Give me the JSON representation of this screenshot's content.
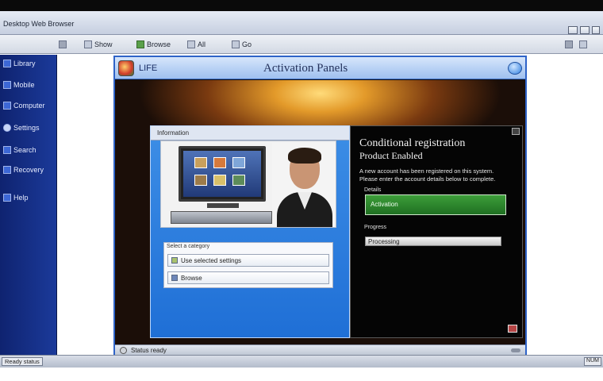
{
  "window": {
    "title": "Desktop Web Browser"
  },
  "toolbar": {
    "items": [
      {
        "label": "Show",
        "icon": "eye-icon"
      },
      {
        "label": "Browse",
        "icon": "browse-icon"
      },
      {
        "label": "All",
        "icon": "grid-icon"
      },
      {
        "label": "Go",
        "icon": "go-icon"
      }
    ]
  },
  "sidebar": {
    "items": [
      {
        "label": "Library",
        "icon": "folder-icon"
      },
      {
        "label": "Mobile",
        "icon": "device-icon"
      },
      {
        "label": "Computer",
        "icon": "computer-icon"
      },
      {
        "label": "Settings",
        "icon": "gear-icon"
      },
      {
        "label": "Search",
        "icon": "search-icon"
      },
      {
        "label": "Recovery",
        "icon": "recovery-icon"
      },
      {
        "label": "Help",
        "icon": "help-icon"
      }
    ]
  },
  "app": {
    "short_label": "LIFE",
    "title": "Activation Panels",
    "panel_header": "Information",
    "list_label": "Select a category",
    "list_rows": [
      "Use selected settings",
      "Browse"
    ],
    "status_text": "Status ready",
    "accent": "#2e63c8"
  },
  "activation": {
    "heading": "Conditional registration",
    "subheading": "Product Enabled",
    "desc_line1": "A new account has been registered on this system.",
    "desc_line2": "Please enter the account details below to complete.",
    "field1_label": "Details",
    "field1_value": "Activation",
    "field2_label": "Progress",
    "field2_value": "Processing"
  },
  "statusbar": {
    "left": "Ready status",
    "right": "NUM"
  }
}
